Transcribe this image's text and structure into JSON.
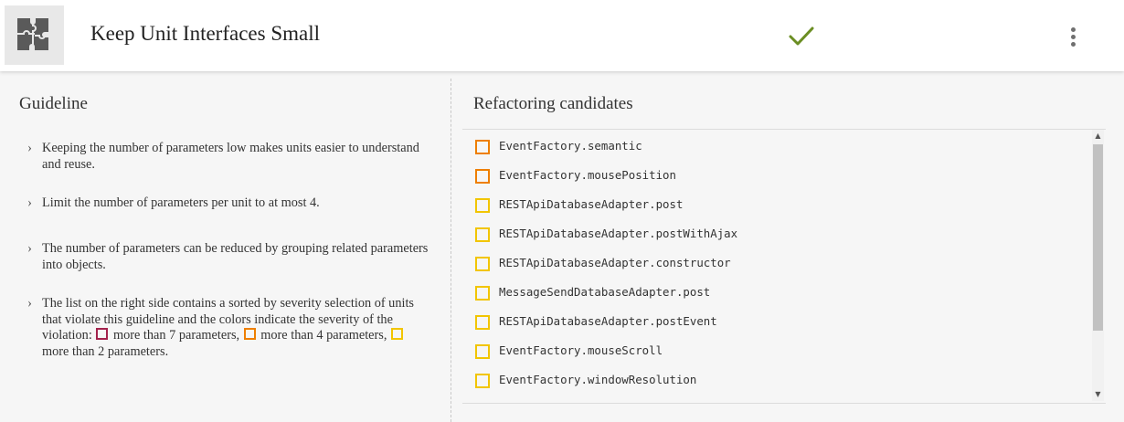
{
  "header": {
    "title": "Keep Unit Interfaces Small",
    "logo_icon": "puzzle-icon",
    "status_icon": "check-icon",
    "status_color": "#6b8e23",
    "menu_icon": "more-vertical-icon"
  },
  "guideline": {
    "title": "Guideline",
    "items": [
      {
        "text": "Keeping the number of parameters low makes units easier to understand and reuse."
      },
      {
        "text": "Limit the number of parameters per unit to at most 4."
      },
      {
        "text": "The number of parameters can be reduced by grouping related parameters into objects."
      },
      {
        "text_before": "The list on the right side contains a sorted by severity selection of units that violate this guideline and the colors indicate the severity of the violation:",
        "sev1": "more than 7 parameters,",
        "sev2": "more than 4 parameters,",
        "sev3": "more than 2 parameters."
      }
    ]
  },
  "severity_colors": {
    "high": "#a3224c",
    "medium": "#ee7f00",
    "low": "#f2c500"
  },
  "refactoring": {
    "title": "Refactoring candidates",
    "items": [
      {
        "label": "EventFactory.semantic",
        "severity": "medium"
      },
      {
        "label": "EventFactory.mousePosition",
        "severity": "medium"
      },
      {
        "label": "RESTApiDatabaseAdapter.post",
        "severity": "low"
      },
      {
        "label": "RESTApiDatabaseAdapter.postWithAjax",
        "severity": "low"
      },
      {
        "label": "RESTApiDatabaseAdapter.constructor",
        "severity": "low"
      },
      {
        "label": "MessageSendDatabaseAdapter.post",
        "severity": "low"
      },
      {
        "label": "RESTApiDatabaseAdapter.postEvent",
        "severity": "low"
      },
      {
        "label": "EventFactory.mouseScroll",
        "severity": "low"
      },
      {
        "label": "EventFactory.windowResolution",
        "severity": "low"
      }
    ]
  }
}
